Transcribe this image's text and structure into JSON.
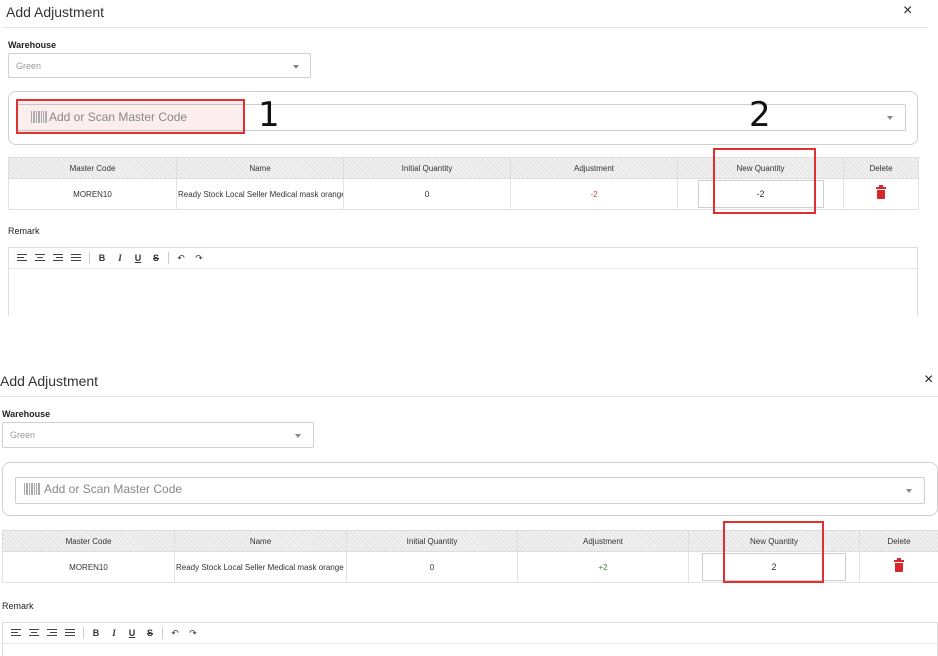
{
  "panels": [
    {
      "title": "Add Adjustment",
      "close_glyph": "×",
      "warehouse_label": "Warehouse",
      "warehouse_value": "Green",
      "scan_placeholder": "Add or Scan Master Code",
      "columns": [
        "Master Code",
        "Name",
        "Initial Quantity",
        "Adjustment",
        "New Quantity",
        "Delete"
      ],
      "row": {
        "master_code": "MOREN10",
        "name": "Ready Stock Local Seller Medical mask orange",
        "initial_quantity": "0",
        "adjustment": "-2",
        "new_quantity": "-2"
      },
      "remark_label": "Remark",
      "step_labels": [
        "1",
        "2"
      ]
    },
    {
      "title": "Add Adjustment",
      "close_glyph": "×",
      "warehouse_label": "Warehouse",
      "warehouse_value": "Green",
      "scan_placeholder": "Add or Scan Master Code",
      "columns": [
        "Master Code",
        "Name",
        "Initial Quantity",
        "Adjustment",
        "New Quantity",
        "Delete"
      ],
      "row": {
        "master_code": "MOREN10",
        "name": "Ready Stock Local Seller Medical mask orange",
        "initial_quantity": "0",
        "adjustment": "+2",
        "new_quantity": "2"
      },
      "remark_label": "Remark"
    }
  ],
  "toolbar": {
    "bold": "B",
    "italic": "I",
    "underline": "U",
    "strike": "S",
    "undo": "↶",
    "redo": "↷"
  },
  "colors": {
    "highlight": "#e03030",
    "negative": "#d83a3a",
    "positive": "#2e8b2e",
    "delete": "#d9262c"
  },
  "icons": [
    "close-icon",
    "chevron-down-icon",
    "barcode-icon",
    "trash-icon",
    "align-left-icon",
    "align-center-icon",
    "align-right-icon",
    "align-justify-icon",
    "undo-icon",
    "redo-icon"
  ]
}
